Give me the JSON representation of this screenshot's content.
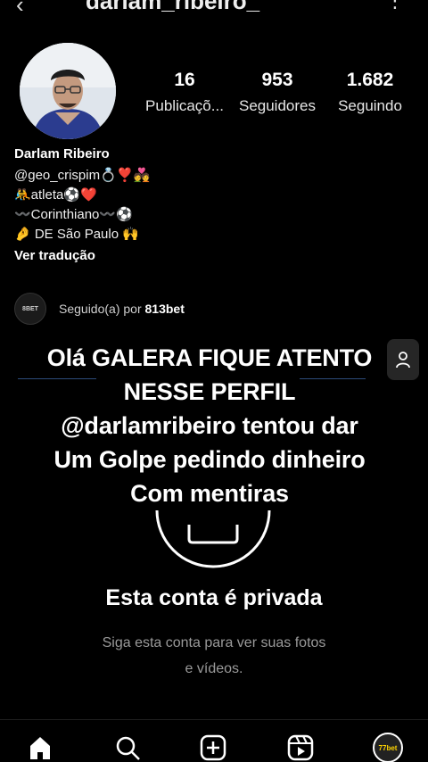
{
  "header": {
    "back_glyph": "‹",
    "username": "darlam_ribeiro_",
    "more_glyph": "⋮"
  },
  "profile": {
    "stats": [
      {
        "value": "16",
        "label": "Publicaçõ..."
      },
      {
        "value": "953",
        "label": "Seguidores"
      },
      {
        "value": "1.682",
        "label": "Seguindo"
      }
    ],
    "name": "Darlam Ribeiro",
    "bio_lines": [
      "@geo_crispim💍❣️💑",
      "🤼atleta⚽❤️",
      "〰️Corinthiano〰️⚽",
      "🤌 DE São Paulo 🙌"
    ],
    "translate_label": "Ver tradução",
    "followed_by": {
      "prefix": "Seguido(a) por ",
      "account": "813bet",
      "avatar_text": "8BET"
    }
  },
  "overlay_text": [
    "Olá GALERA  FIQUE ATENTO",
    "NESSE PERFIL",
    "@darlamribeiro  tentou dar",
    "Um Golpe pedindo dinheiro",
    "Com mentiras"
  ],
  "private": {
    "title": "Esta conta é privada",
    "subtitle_line1": "Siga esta conta para ver suas fotos",
    "subtitle_line2": "e vídeos."
  },
  "tabbar": {
    "items": [
      {
        "icon": "home-icon"
      },
      {
        "icon": "search-icon"
      },
      {
        "icon": "new-post-icon"
      },
      {
        "icon": "reels-icon"
      },
      {
        "icon": "profile-avatar",
        "text": "77bet"
      }
    ]
  },
  "colors": {
    "background": "#000000",
    "text": "#f5f5f5",
    "muted": "#9a9a9a",
    "divider": "#2d4b7a"
  }
}
